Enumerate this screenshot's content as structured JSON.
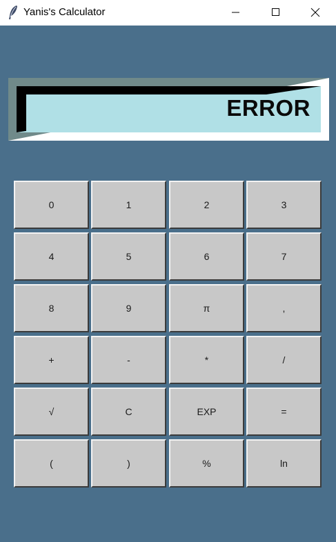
{
  "window": {
    "title": "Yanis's Calculator",
    "icon": "feather-icon",
    "controls": [
      "minimize-icon",
      "maximize-icon",
      "close-icon"
    ]
  },
  "display": {
    "value": "ERROR",
    "background_color": "#b0e0e6"
  },
  "colors": {
    "window_background": "#4a6f8b",
    "button_face": "#c8c8c8"
  },
  "keypad": {
    "rows": [
      [
        "0",
        "1",
        "2",
        "3"
      ],
      [
        "4",
        "5",
        "6",
        "7"
      ],
      [
        "8",
        "9",
        "π",
        ","
      ],
      [
        "+",
        "-",
        "*",
        "/"
      ],
      [
        "√",
        "C",
        "EXP",
        "="
      ],
      [
        "(",
        ")",
        "%",
        "ln"
      ]
    ]
  }
}
